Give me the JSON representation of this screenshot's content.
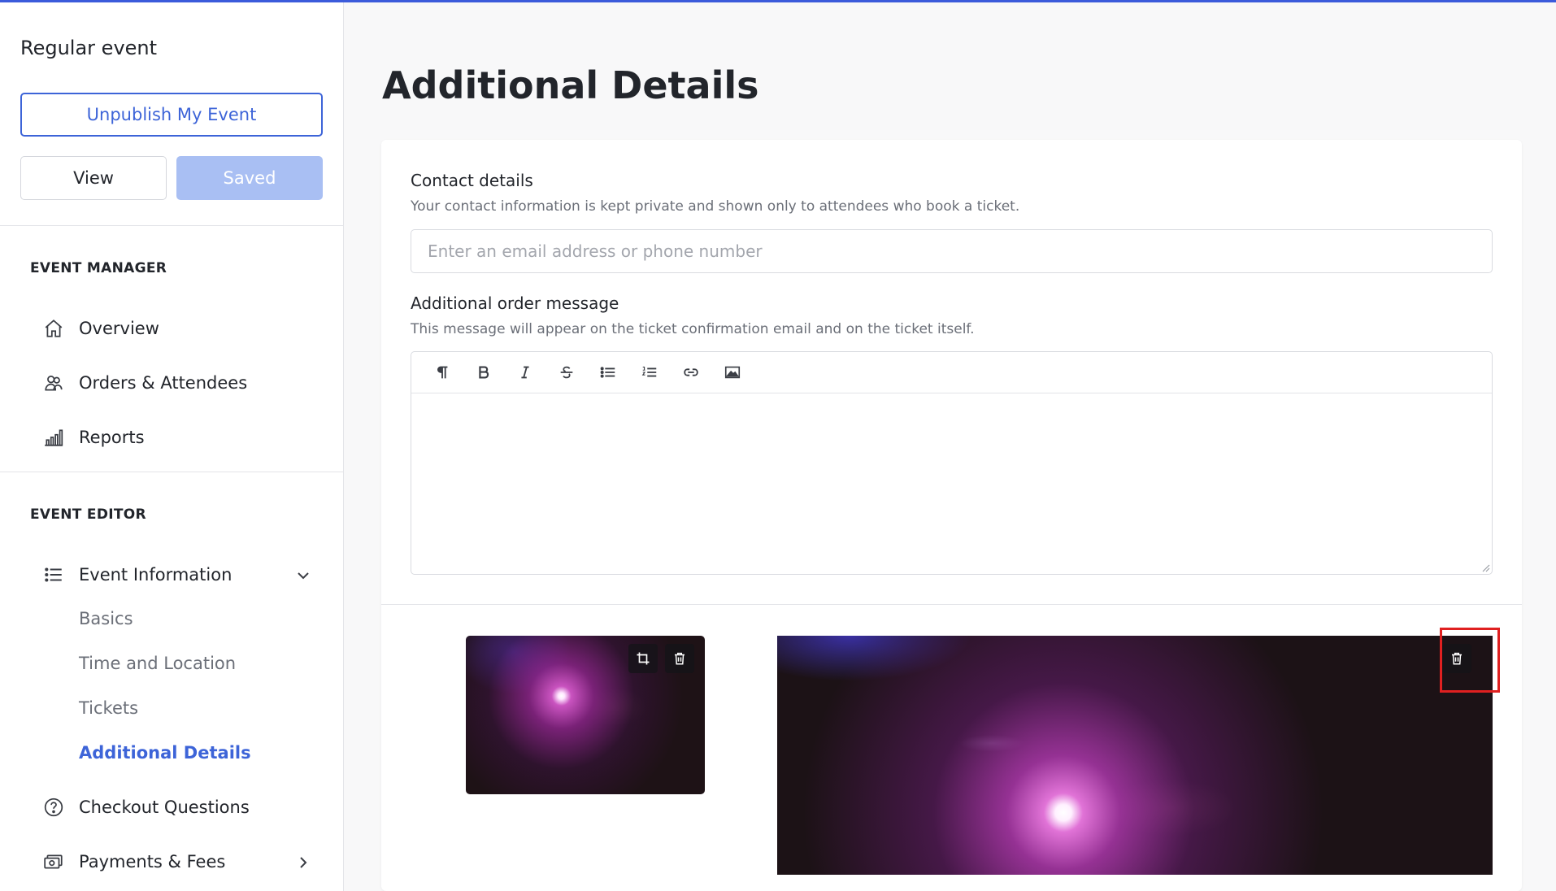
{
  "sidebar": {
    "event_name": "Regular event",
    "unpublish_label": "Unpublish My Event",
    "view_label": "View",
    "saved_label": "Saved",
    "event_manager": {
      "title": "EVENT MANAGER",
      "items": [
        {
          "label": "Overview",
          "icon": "home-icon"
        },
        {
          "label": "Orders & Attendees",
          "icon": "users-icon"
        },
        {
          "label": "Reports",
          "icon": "bar-chart-icon"
        }
      ]
    },
    "event_editor": {
      "title": "EVENT EDITOR",
      "event_information": {
        "label": "Event Information",
        "icon": "list-icon"
      },
      "sub_items": [
        "Basics",
        "Time and Location",
        "Tickets",
        "Additional Details"
      ],
      "active_sub_item": "Additional Details",
      "checkout_questions": {
        "label": "Checkout Questions",
        "icon": "question-circle-icon"
      },
      "payments_fees": {
        "label": "Payments & Fees",
        "icon": "money-icon"
      }
    }
  },
  "main": {
    "title": "Additional Details",
    "contact": {
      "label": "Contact details",
      "help": "Your contact information is kept private and shown only to attendees who book a ticket.",
      "placeholder": "Enter an email address or phone number",
      "value": ""
    },
    "order_message": {
      "label": "Additional order message",
      "help": "This message will appear on the ticket confirmation email and on the ticket itself.",
      "toolbar": [
        "paragraph-icon",
        "bold-icon",
        "italic-icon",
        "strikethrough-icon",
        "bullet-list-icon",
        "numbered-list-icon",
        "link-icon",
        "image-icon"
      ]
    },
    "images": {
      "thumbnail_actions": [
        "crop-icon",
        "trash-icon"
      ],
      "banner_actions": [
        "trash-icon"
      ]
    }
  },
  "colors": {
    "accent": "#3d64d8",
    "saved_button": "#a9bff3",
    "highlight": "#e02020"
  }
}
